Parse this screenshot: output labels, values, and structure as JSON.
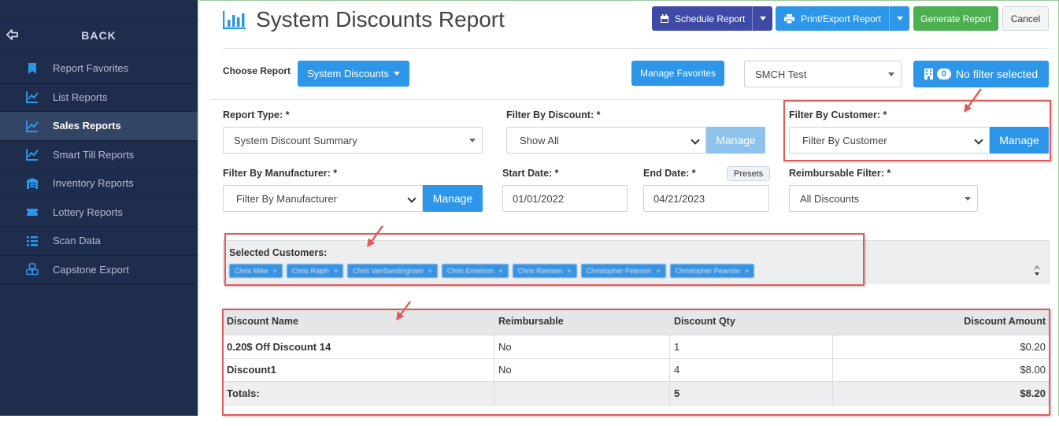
{
  "sidebar": {
    "back_label": "BACK",
    "items": [
      {
        "label": "Report Favorites",
        "icon": "bookmark-icon"
      },
      {
        "label": "List Reports",
        "icon": "line-chart-icon"
      },
      {
        "label": "Sales Reports",
        "icon": "line-chart-icon",
        "active": true
      },
      {
        "label": "Smart Till Reports",
        "icon": "line-chart-icon"
      },
      {
        "label": "Inventory Reports",
        "icon": "warehouse-icon"
      },
      {
        "label": "Lottery Reports",
        "icon": "ticket-icon"
      },
      {
        "label": "Scan Data",
        "icon": "list-icon"
      },
      {
        "label": "Capstone Export",
        "icon": "cubes-icon"
      }
    ]
  },
  "header": {
    "title": "System Discounts Report",
    "schedule_label": "Schedule Report",
    "print_label": "Print/Export Report",
    "generate_label": "Generate Report",
    "cancel_label": "Cancel"
  },
  "toolbar": {
    "choose_report_label": "Choose Report",
    "report_selected": "System Discounts",
    "manage_favorites_label": "Manage Favorites",
    "store_selected": "SMCH Test",
    "filter_count": "0",
    "filter_label": "No filter selected"
  },
  "form": {
    "report_type_label": "Report Type: *",
    "report_type_value": "System Discount Summary",
    "filter_discount_label": "Filter By Discount: *",
    "filter_discount_value": "Show All",
    "filter_customer_label": "Filter By Customer: *",
    "filter_customer_value": "Filter By Customer",
    "filter_manufacturer_label": "Filter By Manufacturer: *",
    "filter_manufacturer_value": "Filter By Manufacturer",
    "start_date_label": "Start Date: *",
    "start_date_value": "01/01/2022",
    "end_date_label": "End Date: *",
    "end_date_value": "04/21/2023",
    "presets_label": "Presets",
    "reimbursable_label": "Reimbursable Filter: *",
    "reimbursable_value": "All Discounts",
    "manage_label": "Manage"
  },
  "selected_customers": {
    "label": "Selected Customers:",
    "chips": [
      "Chris Mike",
      "Chris Ralph",
      "Chris VanSandingham",
      "Chris Emerson",
      "Chris Ramsen",
      "Christopher Pearson",
      "Christopher Pearson"
    ]
  },
  "table": {
    "headers": [
      "Discount Name",
      "Reimbursable",
      "Discount Qty",
      "Discount Amount"
    ],
    "rows": [
      [
        "0.20$ Off Discount 14",
        "No",
        "1",
        "$0.20"
      ],
      [
        "Discount1",
        "No",
        "4",
        "$8.00"
      ]
    ],
    "totals": [
      "Totals:",
      "",
      "5",
      "$8.20"
    ]
  },
  "colors": {
    "sidebar_bg": "#1f2d4d",
    "accent_blue": "#2d96e8",
    "schedule_purple": "#3f4aa6",
    "generate_green": "#4caf50",
    "highlight_red": "#e05b5b"
  }
}
